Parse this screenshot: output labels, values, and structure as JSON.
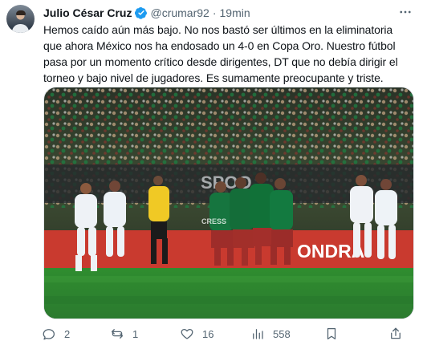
{
  "author": {
    "display_name": "Julio César Cruz",
    "handle": "@crumar92",
    "separator": "·",
    "timestamp": "19min",
    "verified_color": "#1d9bf0"
  },
  "tweet": {
    "text": "Hemos caído aún más bajo. No nos bastó ser últimos en la eliminatoria\nque ahora México nos ha endosado un 4-0 en Copa Oro. Nuestro fútbol\npasa por un momento crítico desde dirigentes, DT que no debía dirigir el\ntorneo y bajo nivel de jugadores. Es sumamente preocupante y triste."
  },
  "media": {
    "board_text": "ONDRA",
    "watermark": "CRESS"
  },
  "actions": {
    "replies": "2",
    "retweets": "1",
    "likes": "16",
    "views": "558"
  },
  "icons": {
    "more": "more-horizontal-icon",
    "reply": "reply-icon",
    "retweet": "retweet-icon",
    "like": "heart-icon",
    "views": "views-icon",
    "bookmark": "bookmark-icon",
    "share": "share-icon"
  },
  "colors": {
    "text": "#0f1419",
    "muted": "#536471",
    "verified": "#1d9bf0",
    "pitch": "#2f8f2f",
    "board": "#c93a2f"
  }
}
